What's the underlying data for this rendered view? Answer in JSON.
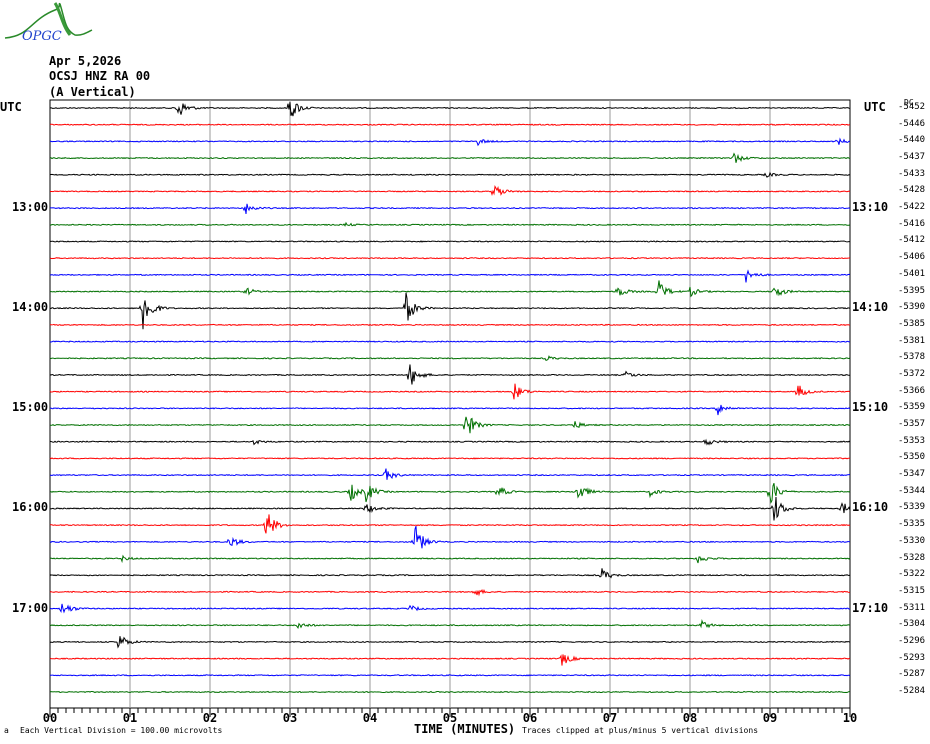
{
  "logo_text": "OPGC",
  "header": {
    "date": "Apr 5,2026",
    "station": "OCSJ HNZ RA 00",
    "component": "(A Vertical)"
  },
  "left_tz": "UTC",
  "right_tz": "UTC",
  "dc_label": "DC",
  "hour_labels_left": [
    {
      "trace": 6,
      "label": "13:00"
    },
    {
      "trace": 12,
      "label": "14:00"
    },
    {
      "trace": 18,
      "label": "15:00"
    },
    {
      "trace": 24,
      "label": "16:00"
    },
    {
      "trace": 30,
      "label": "17:00"
    }
  ],
  "hour_labels_right": [
    {
      "trace": 6,
      "label": "13:10"
    },
    {
      "trace": 12,
      "label": "14:10"
    },
    {
      "trace": 18,
      "label": "15:10"
    },
    {
      "trace": 24,
      "label": "16:10"
    },
    {
      "trace": 30,
      "label": "17:10"
    }
  ],
  "footer": {
    "mark": "a",
    "scale": "Each Vertical Division =  100.00 microvolts",
    "xlabel": "TIME (MINUTES)",
    "clip": "Traces clipped at plus/minus 5 vertical divisions"
  },
  "chart_data": {
    "type": "line",
    "title": "Helicorder seismogram",
    "xlabel": "TIME (MINUTES)",
    "xlim": [
      0,
      10
    ],
    "x_ticks": [
      "00",
      "01",
      "02",
      "03",
      "04",
      "05",
      "06",
      "07",
      "08",
      "09",
      "10"
    ],
    "trace_colors": [
      "#000000",
      "#ff0000",
      "#0000ff",
      "#007000"
    ],
    "dc_offsets": [
      -5452,
      -5446,
      -5440,
      -5437,
      -5433,
      -5428,
      -5422,
      -5416,
      -5412,
      -5406,
      -5401,
      -5395,
      -5390,
      -5385,
      -5381,
      -5378,
      -5372,
      -5366,
      -5359,
      -5357,
      -5353,
      -5350,
      -5347,
      -5344,
      -5339,
      -5335,
      -5330,
      -5328,
      -5322,
      -5315,
      -5311,
      -5304,
      -5296,
      -5293,
      -5287,
      -5284
    ],
    "events": [
      {
        "trace": 0,
        "minute": 1.6,
        "amp": 1.4
      },
      {
        "trace": 0,
        "minute": 3.0,
        "amp": 1.6
      },
      {
        "trace": 2,
        "minute": 5.35,
        "amp": 0.4
      },
      {
        "trace": 2,
        "minute": 9.85,
        "amp": 0.4
      },
      {
        "trace": 3,
        "minute": 8.55,
        "amp": 0.7
      },
      {
        "trace": 4,
        "minute": 8.95,
        "amp": 0.3
      },
      {
        "trace": 5,
        "minute": 5.55,
        "amp": 1.0
      },
      {
        "trace": 6,
        "minute": 2.45,
        "amp": 0.7
      },
      {
        "trace": 7,
        "minute": 3.7,
        "amp": 0.2
      },
      {
        "trace": 10,
        "minute": 8.7,
        "amp": 0.9
      },
      {
        "trace": 11,
        "minute": 2.45,
        "amp": 0.5
      },
      {
        "trace": 11,
        "minute": 7.1,
        "amp": 0.7
      },
      {
        "trace": 11,
        "minute": 7.6,
        "amp": 1.5
      },
      {
        "trace": 11,
        "minute": 8.0,
        "amp": 0.6
      },
      {
        "trace": 11,
        "minute": 9.05,
        "amp": 1.0
      },
      {
        "trace": 12,
        "minute": 1.15,
        "amp": 3.5
      },
      {
        "trace": 12,
        "minute": 4.45,
        "amp": 2.0
      },
      {
        "trace": 15,
        "minute": 6.2,
        "amp": 0.3
      },
      {
        "trace": 16,
        "minute": 4.5,
        "amp": 1.6
      },
      {
        "trace": 16,
        "minute": 7.2,
        "amp": 0.4
      },
      {
        "trace": 17,
        "minute": 5.8,
        "amp": 1.1
      },
      {
        "trace": 17,
        "minute": 9.35,
        "amp": 0.9
      },
      {
        "trace": 18,
        "minute": 8.35,
        "amp": 0.8
      },
      {
        "trace": 19,
        "minute": 5.2,
        "amp": 1.8
      },
      {
        "trace": 19,
        "minute": 6.55,
        "amp": 0.5
      },
      {
        "trace": 20,
        "minute": 2.55,
        "amp": 0.3
      },
      {
        "trace": 20,
        "minute": 8.2,
        "amp": 0.5
      },
      {
        "trace": 22,
        "minute": 4.2,
        "amp": 0.8
      },
      {
        "trace": 23,
        "minute": 3.75,
        "amp": 1.2
      },
      {
        "trace": 23,
        "minute": 3.95,
        "amp": 1.2
      },
      {
        "trace": 23,
        "minute": 5.6,
        "amp": 0.8
      },
      {
        "trace": 23,
        "minute": 6.6,
        "amp": 1.2
      },
      {
        "trace": 23,
        "minute": 7.5,
        "amp": 0.5
      },
      {
        "trace": 23,
        "minute": 9.0,
        "amp": 1.8
      },
      {
        "trace": 24,
        "minute": 3.95,
        "amp": 0.8
      },
      {
        "trace": 24,
        "minute": 9.05,
        "amp": 1.9
      },
      {
        "trace": 24,
        "minute": 9.9,
        "amp": 0.8
      },
      {
        "trace": 25,
        "minute": 2.7,
        "amp": 2.1
      },
      {
        "trace": 26,
        "minute": 2.25,
        "amp": 0.8
      },
      {
        "trace": 26,
        "minute": 4.55,
        "amp": 2.5
      },
      {
        "trace": 27,
        "minute": 0.9,
        "amp": 0.3
      },
      {
        "trace": 27,
        "minute": 8.1,
        "amp": 0.6
      },
      {
        "trace": 28,
        "minute": 6.9,
        "amp": 0.8
      },
      {
        "trace": 29,
        "minute": 5.3,
        "amp": 0.6
      },
      {
        "trace": 30,
        "minute": 0.15,
        "amp": 1.0
      },
      {
        "trace": 30,
        "minute": 4.5,
        "amp": 0.4
      },
      {
        "trace": 31,
        "minute": 3.1,
        "amp": 0.5
      },
      {
        "trace": 31,
        "minute": 8.15,
        "amp": 0.5
      },
      {
        "trace": 32,
        "minute": 0.85,
        "amp": 1.2
      },
      {
        "trace": 33,
        "minute": 6.4,
        "amp": 0.9
      }
    ]
  }
}
